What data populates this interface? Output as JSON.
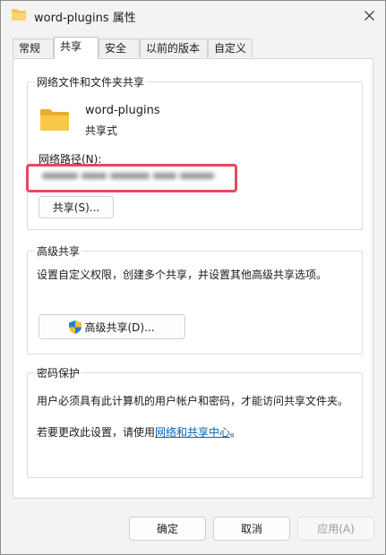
{
  "window": {
    "title": "word-plugins 属性",
    "close_icon": "close-icon"
  },
  "tabs": [
    {
      "label": "常规",
      "active": false
    },
    {
      "label": "共享",
      "active": true
    },
    {
      "label": "安全",
      "active": false
    },
    {
      "label": "以前的版本",
      "active": false
    },
    {
      "label": "自定义",
      "active": false
    }
  ],
  "network_sharing": {
    "group_title": "网络文件和文件夹共享",
    "folder_name": "word-plugins",
    "status": "共享式",
    "path_label": "网络路径(N):",
    "path_value_redacted": true,
    "share_button": "共享(S)..."
  },
  "advanced_sharing": {
    "group_title": "高级共享",
    "description": "设置自定义权限，创建多个共享，并设置其他高级共享选项。",
    "button": "高级共享(D)...",
    "button_icon": "uac-shield-icon"
  },
  "password_protection": {
    "group_title": "密码保护",
    "description": "用户必须具有此计算机的用户帐户和密码，才能访问共享文件夹。",
    "change_prefix": "若要更改此设置，请使用",
    "link_text": "网络和共享中心",
    "change_suffix": "。"
  },
  "footer": {
    "ok": "确定",
    "cancel": "取消",
    "apply": "应用(A)"
  },
  "colors": {
    "highlight": "#e8475f",
    "link": "#0063b1",
    "folder": "#f6c445"
  }
}
